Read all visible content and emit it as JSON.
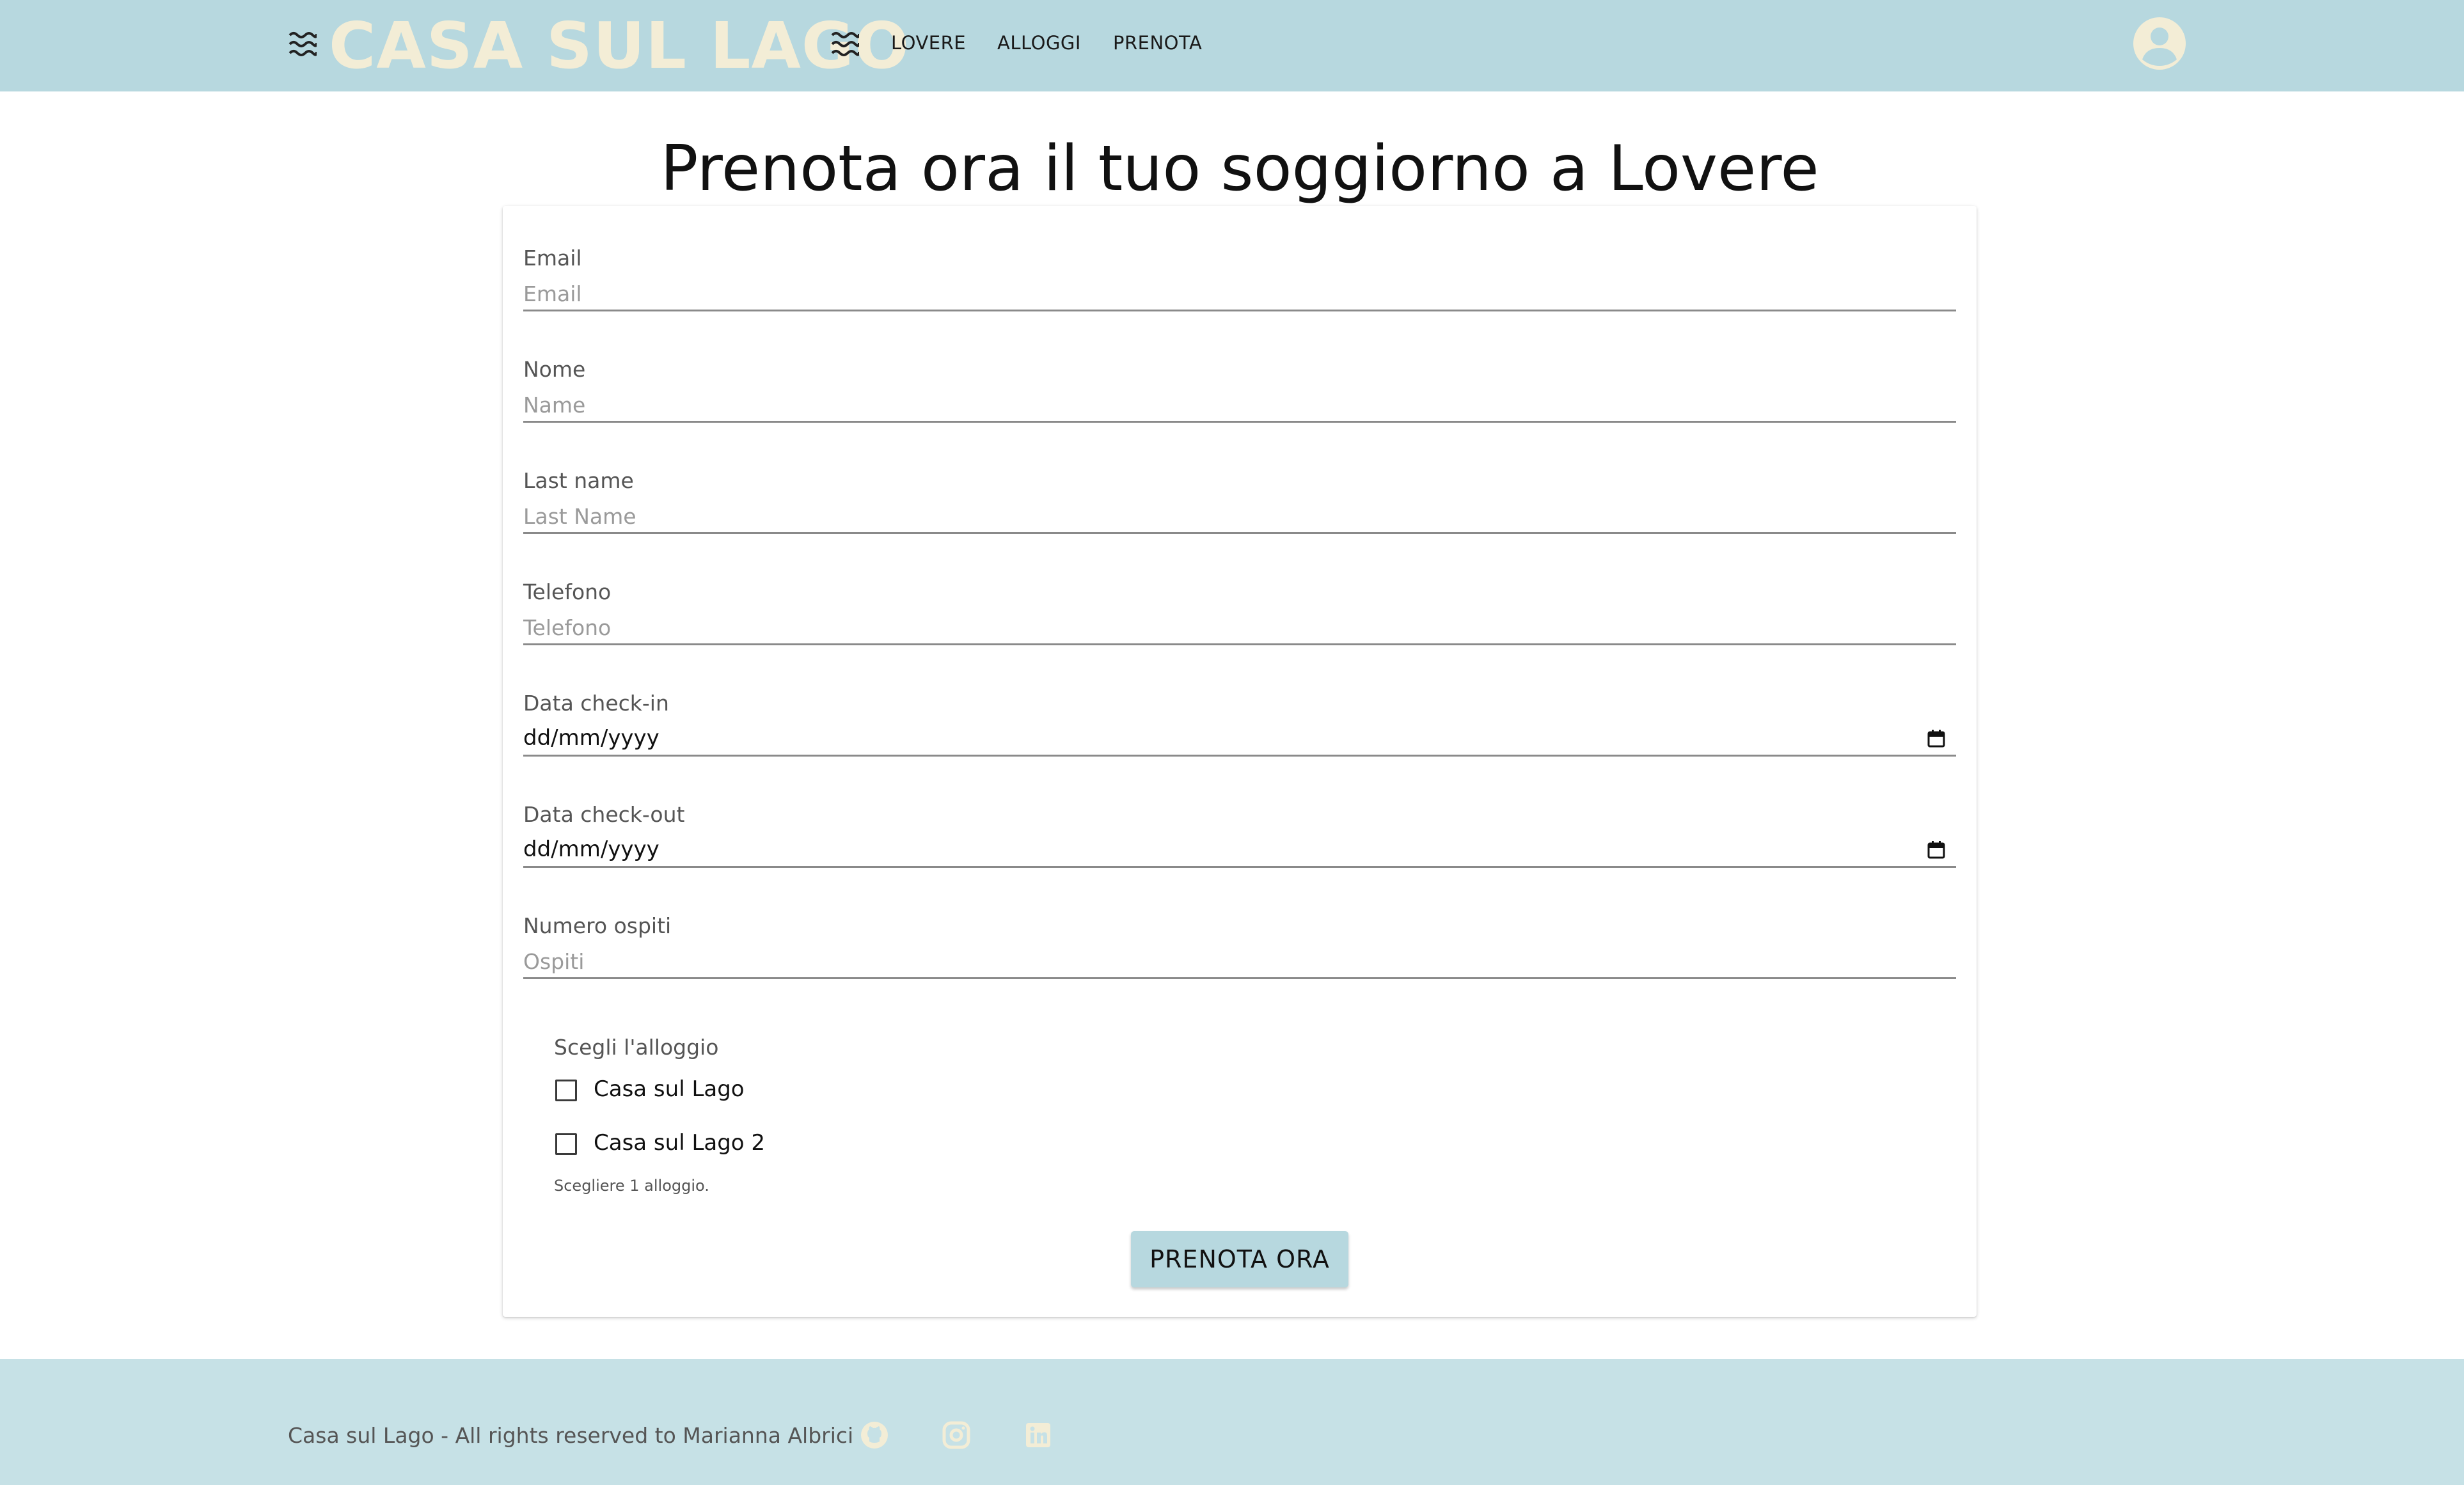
{
  "header": {
    "brand": "CASA SUL LAGO",
    "nav": [
      {
        "label": "LOVERE"
      },
      {
        "label": "ALLOGGI"
      },
      {
        "label": "PRENOTA"
      }
    ],
    "icons": {
      "left_decoration": "waves-icon",
      "right_decoration": "waves-icon",
      "profile": "account-circle-icon"
    }
  },
  "page": {
    "title": "Prenota ora il tuo soggiorno a Lovere"
  },
  "form": {
    "email": {
      "label": "Email",
      "placeholder": "Email",
      "value": ""
    },
    "first_name": {
      "label": "Nome",
      "placeholder": "Name",
      "value": ""
    },
    "last_name": {
      "label": "Last name",
      "placeholder": "Last Name",
      "value": ""
    },
    "phone": {
      "label": "Telefono",
      "placeholder": "Telefono",
      "value": ""
    },
    "checkin": {
      "label": "Data check-in",
      "value": "dd/mm/yyyy"
    },
    "checkout": {
      "label": "Data check-out",
      "value": "dd/mm/yyyy"
    },
    "guests": {
      "label": "Numero ospiti",
      "placeholder": "Ospiti",
      "value": ""
    },
    "accommodation": {
      "label": "Scegli l'alloggio",
      "options": [
        {
          "label": "Casa sul Lago",
          "checked": false
        },
        {
          "label": "Casa sul Lago 2",
          "checked": false
        }
      ],
      "hint": "Scegliere 1 alloggio."
    },
    "submit_label": "PRENOTA ORA"
  },
  "footer": {
    "text": "Casa sul Lago - All rights reserved to Marianna Albrici",
    "social": [
      {
        "icon": "github-icon"
      },
      {
        "icon": "instagram-icon"
      },
      {
        "icon": "linkedin-icon"
      }
    ]
  },
  "colors": {
    "header_bg": "#b7d8df",
    "footer_bg": "#c6e1e6",
    "brand_text": "#f3edd6",
    "button_bg": "#b7d8df"
  }
}
